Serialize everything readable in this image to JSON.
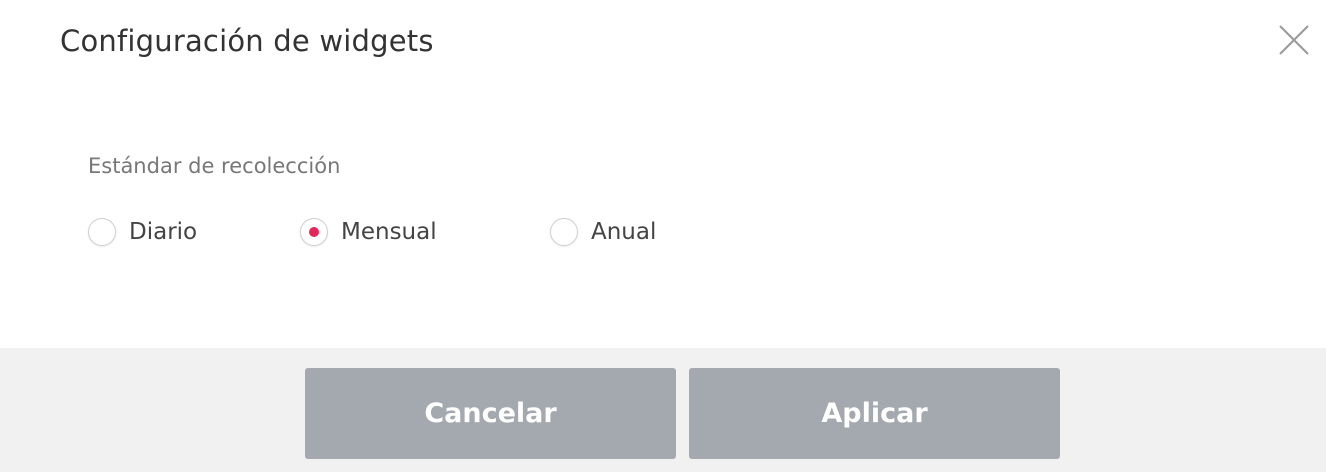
{
  "dialog": {
    "title": "Configuración de widgets"
  },
  "collection": {
    "label": "Estándar de recolección",
    "options": [
      {
        "label": "Diario",
        "checked": false
      },
      {
        "label": "Mensual",
        "checked": true
      },
      {
        "label": "Anual",
        "checked": false
      }
    ],
    "selected": "Mensual"
  },
  "footer": {
    "cancel_label": "Cancelar",
    "apply_label": "Aplicar"
  },
  "colors": {
    "accent": "#e8255b",
    "button_bg": "#a3a9ae",
    "footer_bg": "#f1f1f1"
  },
  "icons": {
    "close": "close-icon"
  }
}
